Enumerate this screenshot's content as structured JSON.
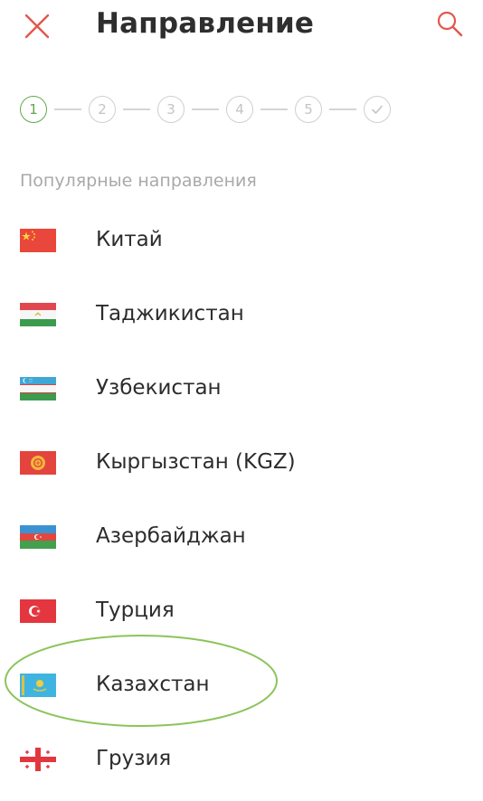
{
  "header": {
    "title": "Направление",
    "close_icon": "close-icon",
    "search_icon": "search-icon"
  },
  "stepper": {
    "steps": [
      "1",
      "2",
      "3",
      "4",
      "5"
    ],
    "final_icon": "check-icon",
    "active_step": "1"
  },
  "section_title": "Популярные направления",
  "destinations": [
    {
      "label": "Китай",
      "flag": "china-flag-icon"
    },
    {
      "label": "Таджикистан",
      "flag": "tajikistan-flag-icon"
    },
    {
      "label": "Узбекистан",
      "flag": "uzbekistan-flag-icon"
    },
    {
      "label": "Кыргызстан (KGZ)",
      "flag": "kyrgyzstan-flag-icon"
    },
    {
      "label": "Азербайджан",
      "flag": "azerbaijan-flag-icon"
    },
    {
      "label": "Турция",
      "flag": "turkey-flag-icon"
    },
    {
      "label": "Казахстан",
      "flag": "kazakhstan-flag-icon"
    },
    {
      "label": "Грузия",
      "flag": "georgia-flag-icon"
    }
  ],
  "colors": {
    "accent_green": "#62a84a",
    "close_red": "#e2574c",
    "search_red": "#e2574c",
    "muted_text": "#a9a9a9"
  }
}
